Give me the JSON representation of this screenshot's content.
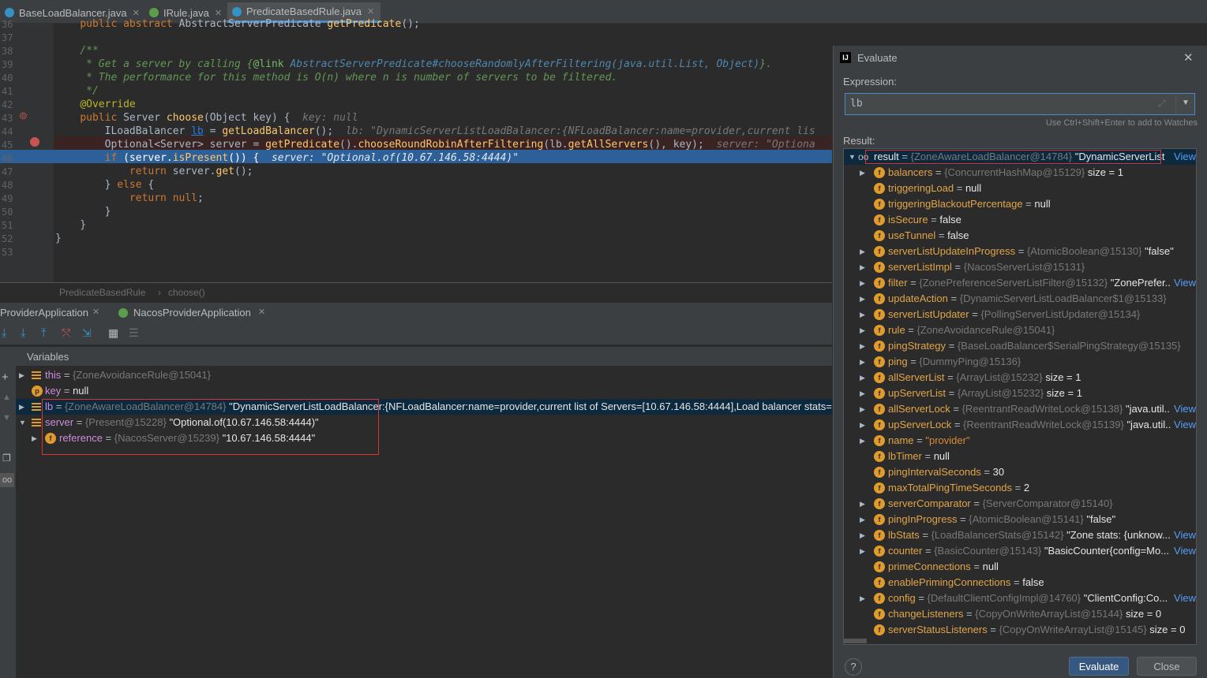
{
  "tabs": [
    {
      "label": "BaseLoadBalancer.java"
    },
    {
      "label": "IRule.java"
    },
    {
      "label": "PredicateBasedRule.java"
    }
  ],
  "code": {
    "lines": [
      {
        "n": "36",
        "text": "    public abstract AbstractServerPredicate getPredicate();"
      },
      {
        "n": "37",
        "text": ""
      },
      {
        "n": "38",
        "text": "    /**"
      },
      {
        "n": "39",
        "text": "     * Get a server by calling {@link AbstractServerPredicate#chooseRandomlyAfterFiltering(java.util.List, Object)}."
      },
      {
        "n": "40",
        "text": "     * The performance for this method is O(n) where n is number of servers to be filtered."
      },
      {
        "n": "41",
        "text": "     */"
      },
      {
        "n": "42",
        "text": "    @Override"
      },
      {
        "n": "43",
        "text": "    public Server choose(Object key) {"
      },
      {
        "n": "44",
        "text": "        ILoadBalancer lb = getLoadBalancer();"
      },
      {
        "n": "45",
        "text": "        Optional<Server> server = getPredicate().chooseRoundRobinAfterFiltering(lb.getAllServers(), key);"
      },
      {
        "n": "46",
        "text": "        if (server.isPresent()) {"
      },
      {
        "n": "47",
        "text": "            return server.get();"
      },
      {
        "n": "48",
        "text": "        } else {"
      },
      {
        "n": "49",
        "text": "            return null;"
      },
      {
        "n": "50",
        "text": "        }"
      },
      {
        "n": "51",
        "text": "    }"
      },
      {
        "n": "52",
        "text": "}"
      },
      {
        "n": "53",
        "text": ""
      }
    ],
    "hint43": "key: null",
    "hint44": "lb: \"DynamicServerListLoadBalancer:{NFLoadBalancer:name=provider,current lis",
    "hint45": "server: \"Optiona",
    "hint46": "server: \"Optional.of(10.67.146.58:4444)\""
  },
  "breadcrumb": {
    "class": "PredicateBasedRule",
    "method": "choose()"
  },
  "debug": {
    "tabs": [
      "ProviderApplication",
      "NacosProviderApplication"
    ],
    "variables_label": "Variables",
    "vars": [
      {
        "name": "this",
        "eq": "=",
        "type": "{ZoneAvoidanceRule@15041}",
        "value": ""
      },
      {
        "name": "key",
        "eq": "=",
        "type": "",
        "value": "null"
      },
      {
        "name": "lb",
        "eq": "=",
        "type": "{ZoneAwareLoadBalancer@14784}",
        "value": "\"DynamicServerListLoadBalancer:{NFLoadBalancer:name=provider,current list of Servers=[10.67.146.58:4444],Load balancer stats=Z"
      },
      {
        "name": "server",
        "eq": "=",
        "type": "{Present@15228}",
        "value": "\"Optional.of(10.67.146.58:4444)\""
      },
      {
        "name": "reference",
        "eq": "=",
        "type": "{NacosServer@15239}",
        "value": "\"10.67.146.58:4444\""
      }
    ]
  },
  "evaluate": {
    "title": "Evaluate",
    "expression_label": "Expression:",
    "expression": "lb",
    "watch_hint": "Use Ctrl+Shift+Enter to add to Watches",
    "result_label": "Result:",
    "view_label": "View",
    "rows": [
      {
        "name": "result",
        "type": "{ZoneAwareLoadBalancer@14784}",
        "value": "\"DynamicServerList"
      },
      {
        "name": "balancers",
        "type": "{ConcurrentHashMap@15129}",
        "value": "size = 1"
      },
      {
        "name": "triggeringLoad",
        "type": "",
        "value": "null"
      },
      {
        "name": "triggeringBlackoutPercentage",
        "type": "",
        "value": "null"
      },
      {
        "name": "isSecure",
        "type": "",
        "value": "false"
      },
      {
        "name": "useTunnel",
        "type": "",
        "value": "false"
      },
      {
        "name": "serverListUpdateInProgress",
        "type": "{AtomicBoolean@15130}",
        "value": "\"false\""
      },
      {
        "name": "serverListImpl",
        "type": "{NacosServerList@15131}",
        "value": ""
      },
      {
        "name": "filter",
        "type": "{ZonePreferenceServerListFilter@15132}",
        "value": "\"ZonePrefer..."
      },
      {
        "name": "updateAction",
        "type": "{DynamicServerListLoadBalancer$1@15133}",
        "value": ""
      },
      {
        "name": "serverListUpdater",
        "type": "{PollingServerListUpdater@15134}",
        "value": ""
      },
      {
        "name": "rule",
        "type": "{ZoneAvoidanceRule@15041}",
        "value": ""
      },
      {
        "name": "pingStrategy",
        "type": "{BaseLoadBalancer$SerialPingStrategy@15135}",
        "value": ""
      },
      {
        "name": "ping",
        "type": "{DummyPing@15136}",
        "value": ""
      },
      {
        "name": "allServerList",
        "type": "{ArrayList@15232}",
        "value": "size = 1"
      },
      {
        "name": "upServerList",
        "type": "{ArrayList@15232}",
        "value": "size = 1"
      },
      {
        "name": "allServerLock",
        "type": "{ReentrantReadWriteLock@15138}",
        "value": "\"java.util..."
      },
      {
        "name": "upServerLock",
        "type": "{ReentrantReadWriteLock@15139}",
        "value": "\"java.util..."
      },
      {
        "name": "name",
        "type": "",
        "value": "\"provider\""
      },
      {
        "name": "lbTimer",
        "type": "",
        "value": "null"
      },
      {
        "name": "pingIntervalSeconds",
        "type": "",
        "value": "30"
      },
      {
        "name": "maxTotalPingTimeSeconds",
        "type": "",
        "value": "2"
      },
      {
        "name": "serverComparator",
        "type": "{ServerComparator@15140}",
        "value": ""
      },
      {
        "name": "pingInProgress",
        "type": "{AtomicBoolean@15141}",
        "value": "\"false\""
      },
      {
        "name": "lbStats",
        "type": "{LoadBalancerStats@15142}",
        "value": "\"Zone stats: {unknow..."
      },
      {
        "name": "counter",
        "type": "{BasicCounter@15143}",
        "value": "\"BasicCounter{config=Mo..."
      },
      {
        "name": "primeConnections",
        "type": "",
        "value": "null"
      },
      {
        "name": "enablePrimingConnections",
        "type": "",
        "value": "false"
      },
      {
        "name": "config",
        "type": "{DefaultClientConfigImpl@14760}",
        "value": "\"ClientConfig:Co..."
      },
      {
        "name": "changeListeners",
        "type": "{CopyOnWriteArrayList@15144}",
        "value": "size = 0"
      },
      {
        "name": "serverStatusListeners",
        "type": "{CopyOnWriteArrayList@15145}",
        "value": "size = 0"
      }
    ],
    "help": "?",
    "evaluate_btn": "Evaluate",
    "close_btn": "Close"
  }
}
